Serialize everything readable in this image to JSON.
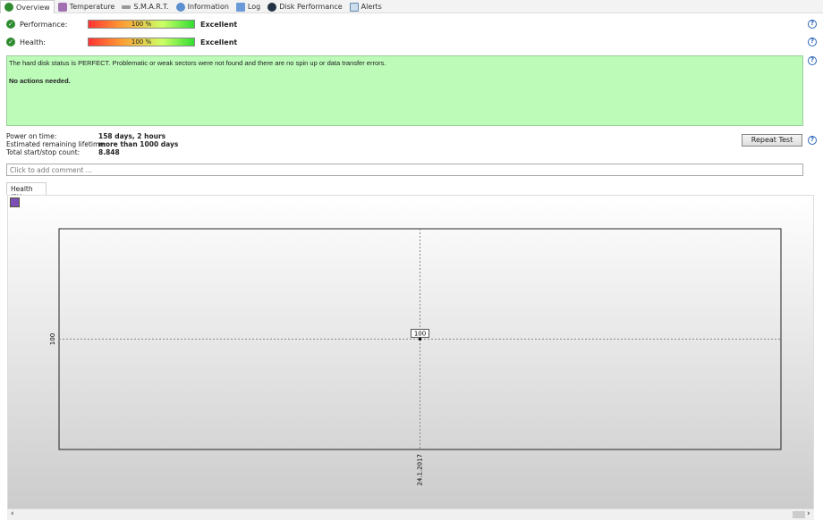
{
  "tabs": [
    {
      "label": "Overview"
    },
    {
      "label": "Temperature"
    },
    {
      "label": "S.M.A.R.T."
    },
    {
      "label": "Information"
    },
    {
      "label": "Log"
    },
    {
      "label": "Disk Performance"
    },
    {
      "label": "Alerts"
    }
  ],
  "performance": {
    "label": "Performance:",
    "percent": "100 %",
    "rating": "Excellent",
    "value": 100
  },
  "health": {
    "label": "Health:",
    "percent": "100 %",
    "rating": "Excellent",
    "value": 100
  },
  "status": {
    "message": "The hard disk status is PERFECT. Problematic or weak sectors were not found and there are no spin up or data transfer errors.",
    "action": "No actions needed.",
    "color": "#bdfbb9"
  },
  "info": [
    {
      "label": "Power on time:",
      "value": "158 days, 2 hours"
    },
    {
      "label": "Estimated remaining lifetime:",
      "value": "more than 1000 days"
    },
    {
      "label": "Total start/stop count:",
      "value": "8.848"
    }
  ],
  "repeat_test": "Repeat Test",
  "comment_placeholder": "Click to add comment ...",
  "chart_tab": "Health (%)",
  "chart_data": {
    "type": "line",
    "x": [
      "24.1.2017"
    ],
    "values": [
      100
    ],
    "point_label": "100",
    "y_tick": "100",
    "x_tick": "24.1.2017"
  }
}
